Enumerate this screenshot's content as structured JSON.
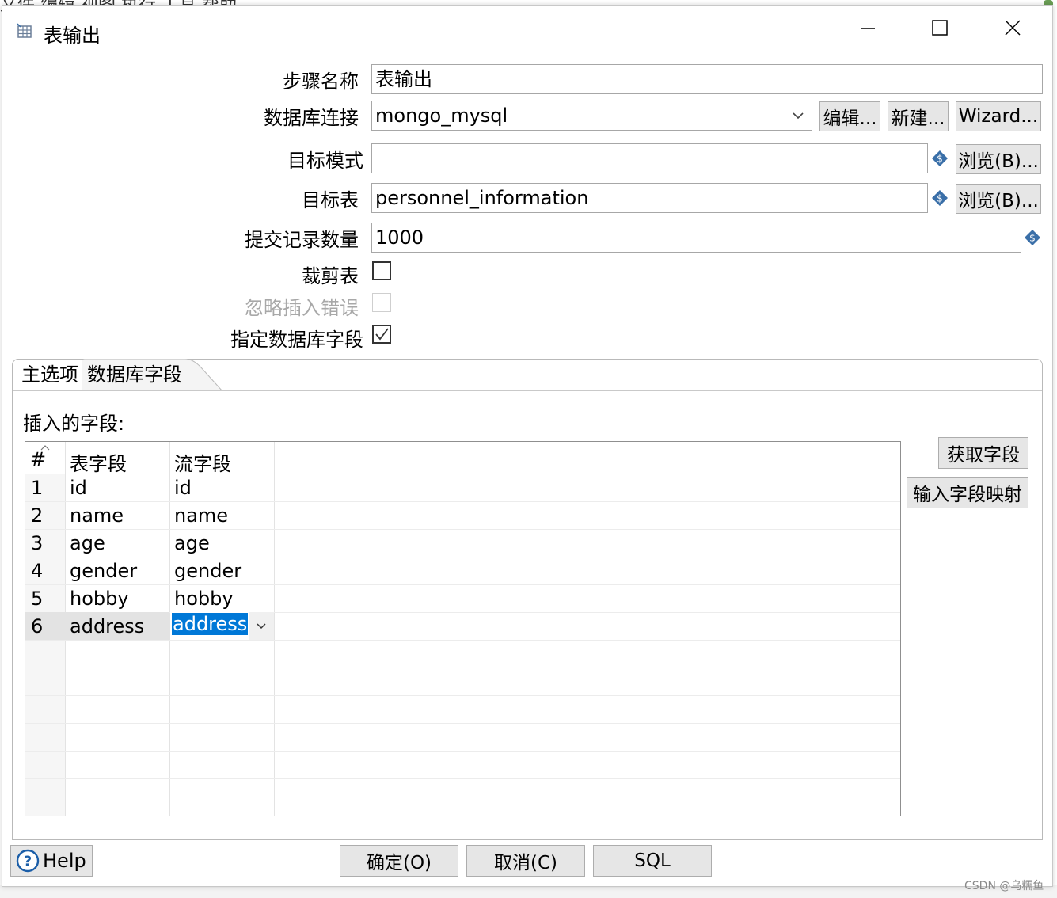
{
  "background_app": {
    "menu_text": "文件 编辑 视图 执行 工具 帮助"
  },
  "dialog": {
    "title": "表输出",
    "window_controls": {
      "minimize": "minimize-icon",
      "maximize": "maximize-icon",
      "close": "close-icon"
    }
  },
  "form": {
    "step_name_label": "步骤名称",
    "step_name_value": "表输出",
    "connection_label": "数据库连接",
    "connection_value": "mongo_mysql",
    "edit_button": "编辑...",
    "new_button": "新建...",
    "wizard_button": "Wizard...",
    "target_schema_label": "目标模式",
    "target_schema_value": "",
    "browse_button_1": "浏览(B)...",
    "target_table_label": "目标表",
    "target_table_value": "personnel_information",
    "browse_button_2": "浏览(B)...",
    "commit_size_label": "提交记录数量",
    "commit_size_value": "1000",
    "truncate_label": "裁剪表",
    "truncate_checked": false,
    "ignore_errors_label": "忽略插入错误",
    "ignore_errors_checked": false,
    "specify_fields_label": "指定数据库字段",
    "specify_fields_checked": true
  },
  "tabs": [
    {
      "label": "主选项",
      "active": false
    },
    {
      "label": "数据库字段",
      "active": true
    }
  ],
  "fields_panel": {
    "section_label": "插入的字段:",
    "columns": [
      "#",
      "表字段",
      "流字段"
    ],
    "rows": [
      {
        "num": "1",
        "table_field": "id",
        "stream_field": "id"
      },
      {
        "num": "2",
        "table_field": "name",
        "stream_field": "name"
      },
      {
        "num": "3",
        "table_field": "age",
        "stream_field": "age"
      },
      {
        "num": "4",
        "table_field": "gender",
        "stream_field": "gender"
      },
      {
        "num": "5",
        "table_field": "hobby",
        "stream_field": "hobby"
      },
      {
        "num": "6",
        "table_field": "address",
        "stream_field": "address"
      }
    ],
    "selected_row": 6,
    "get_fields_button": "获取字段",
    "map_fields_button": "输入字段映射"
  },
  "footer": {
    "help_button": "Help",
    "ok_button": "确定(O)",
    "cancel_button": "取消(C)",
    "sql_button": "SQL"
  },
  "watermark": "CSDN @乌糯鱼",
  "colors": {
    "selection": "#0078d7",
    "button_bg": "#e6e6e6",
    "variable_icon": "#3a6fa8"
  }
}
